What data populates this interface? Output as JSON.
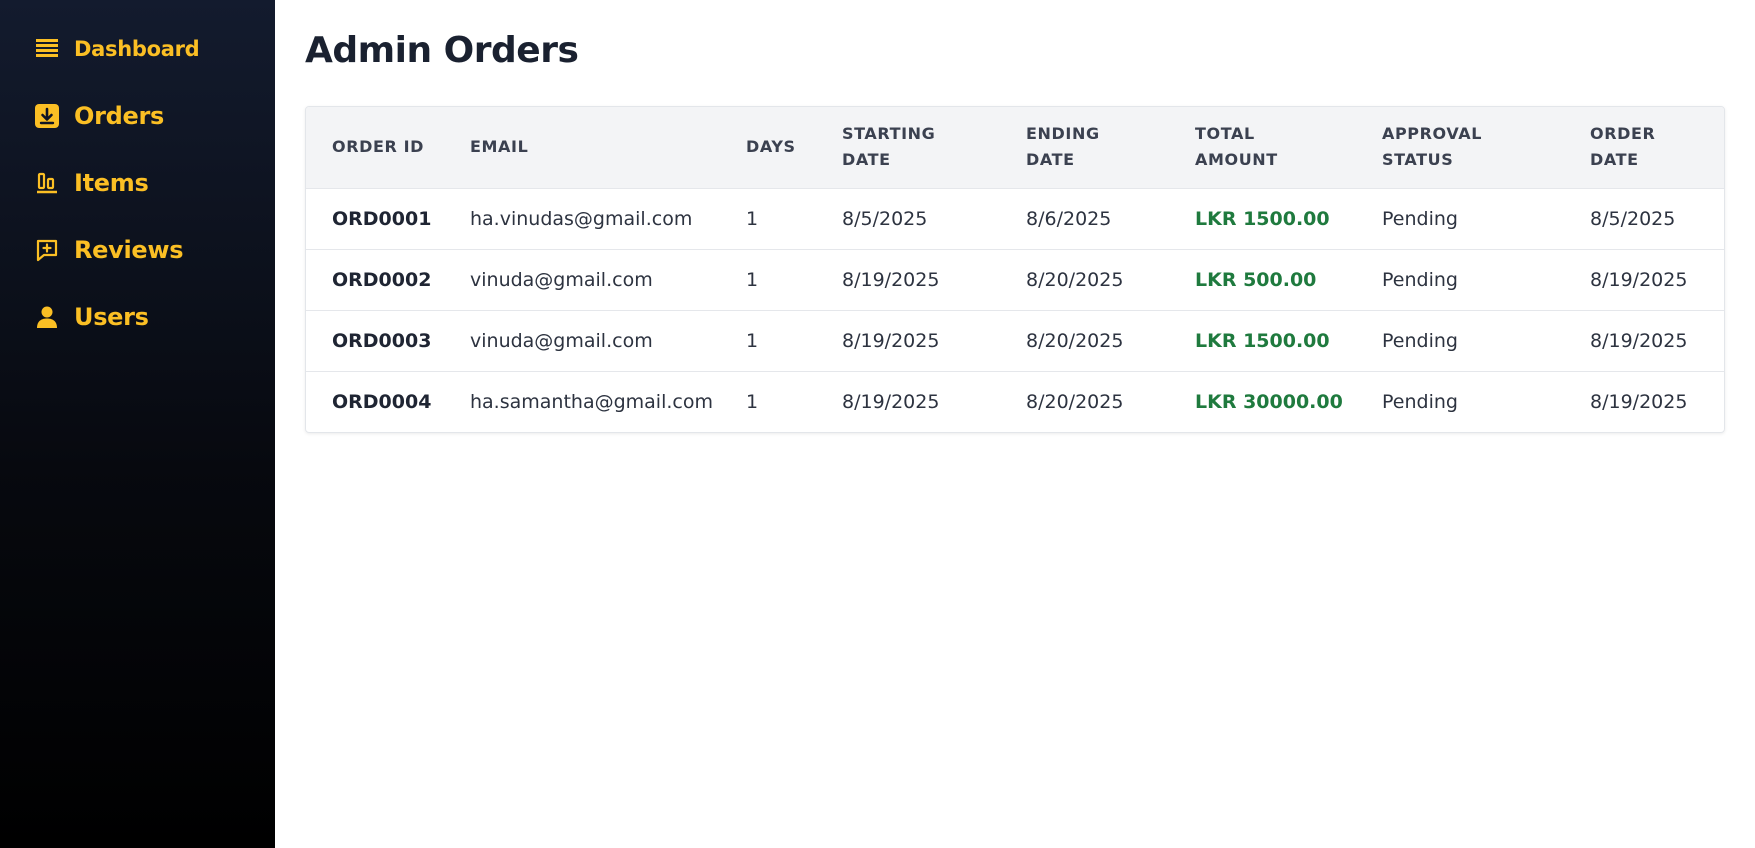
{
  "sidebar": {
    "items": [
      {
        "label": "Dashboard",
        "icon": "dashboard-icon"
      },
      {
        "label": "Orders",
        "icon": "orders-icon"
      },
      {
        "label": "Items",
        "icon": "items-icon"
      },
      {
        "label": "Reviews",
        "icon": "reviews-icon"
      },
      {
        "label": "Users",
        "icon": "user-icon"
      }
    ]
  },
  "colors": {
    "accent": "#fbbf24",
    "amount": "#1f7a3e",
    "title": "#1a2130"
  },
  "main": {
    "title": "Admin Orders",
    "table": {
      "columns": [
        {
          "line1": "ORDER ID",
          "line2": ""
        },
        {
          "line1": "EMAIL",
          "line2": ""
        },
        {
          "line1": "DAYS",
          "line2": ""
        },
        {
          "line1": "STARTING",
          "line2": "DATE"
        },
        {
          "line1": "ENDING",
          "line2": "DATE"
        },
        {
          "line1": "TOTAL",
          "line2": "AMOUNT"
        },
        {
          "line1": "APPROVAL",
          "line2": "STATUS"
        },
        {
          "line1": "ORDER",
          "line2": "DATE"
        }
      ],
      "rows": [
        {
          "order_id": "ORD0001",
          "email": "ha.vinudas@gmail.com",
          "days": "1",
          "starting_date": "8/5/2025",
          "ending_date": "8/6/2025",
          "total_amount": "LKR 1500.00",
          "status": "Pending",
          "order_date": "8/5/2025"
        },
        {
          "order_id": "ORD0002",
          "email": "vinuda@gmail.com",
          "days": "1",
          "starting_date": "8/19/2025",
          "ending_date": "8/20/2025",
          "total_amount": "LKR 500.00",
          "status": "Pending",
          "order_date": "8/19/2025"
        },
        {
          "order_id": "ORD0003",
          "email": "vinuda@gmail.com",
          "days": "1",
          "starting_date": "8/19/2025",
          "ending_date": "8/20/2025",
          "total_amount": "LKR 1500.00",
          "status": "Pending",
          "order_date": "8/19/2025"
        },
        {
          "order_id": "ORD0004",
          "email": "ha.samantha@gmail.com",
          "days": "1",
          "starting_date": "8/19/2025",
          "ending_date": "8/20/2025",
          "total_amount": "LKR 30000.00",
          "status": "Pending",
          "order_date": "8/19/2025"
        }
      ]
    }
  }
}
